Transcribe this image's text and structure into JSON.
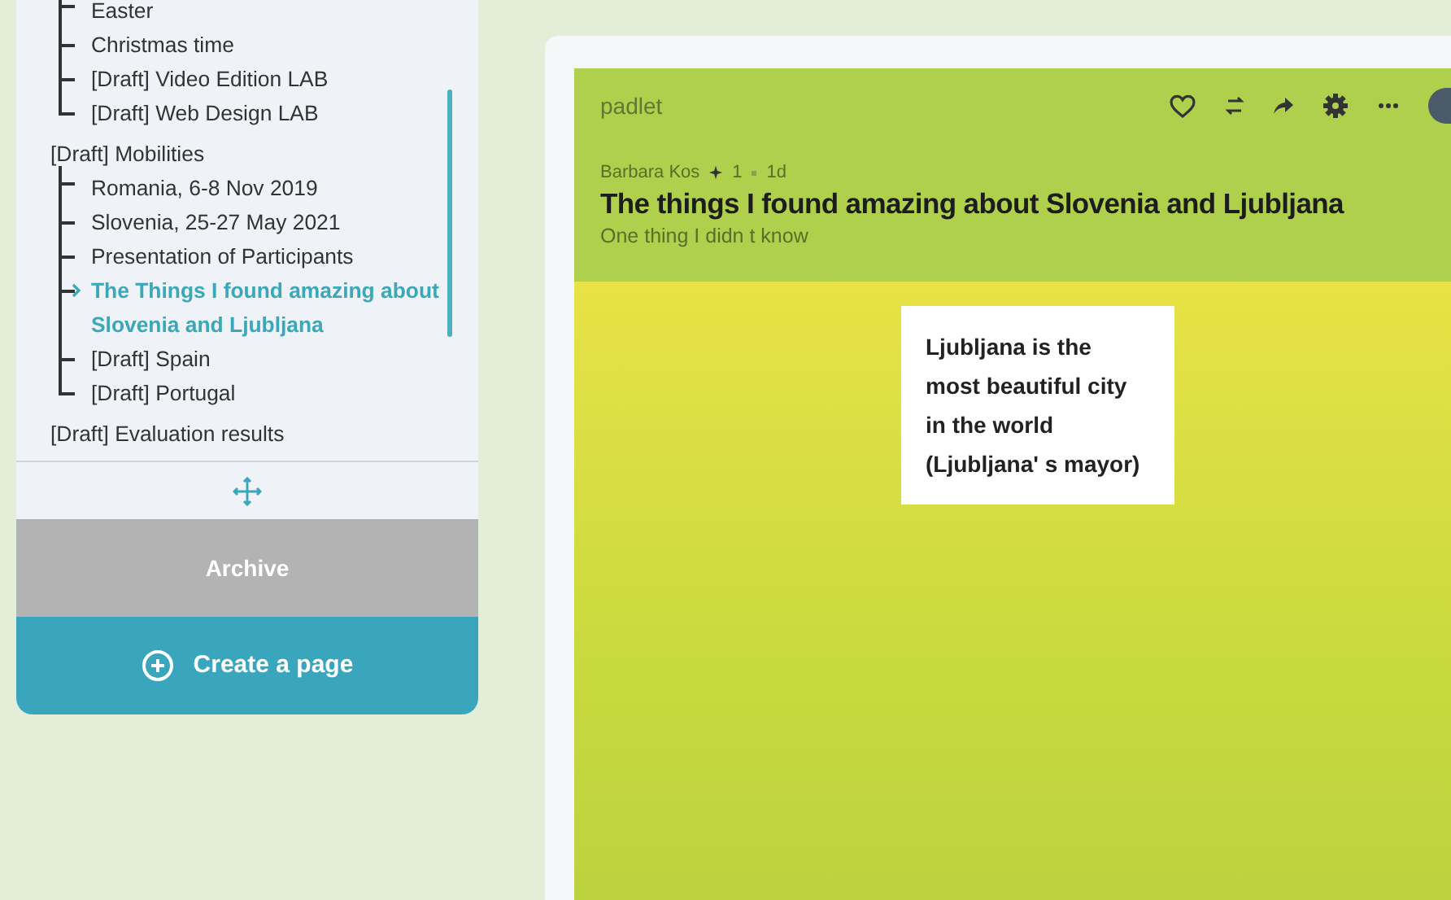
{
  "sidebar": {
    "tree": [
      {
        "children": [
          {
            "label": "Easter",
            "selected": false
          },
          {
            "label": "Christmas time",
            "selected": false
          },
          {
            "label": "[Draft] Video Edition LAB",
            "selected": false
          },
          {
            "label": "[Draft] Web Design LAB",
            "selected": false
          }
        ]
      },
      {
        "label": "[Draft] Mobilities",
        "selected": false,
        "children": [
          {
            "label": "Romania, 6-8 Nov 2019",
            "selected": false
          },
          {
            "label": "Slovenia, 25-27 May 2021",
            "selected": false
          },
          {
            "label": "Presentation of Participants",
            "selected": false
          },
          {
            "label": "The Things I found amazing about Slovenia and Ljubljana",
            "selected": true
          },
          {
            "label": "[Draft] Spain",
            "selected": false
          },
          {
            "label": "[Draft] Portugal",
            "selected": false
          }
        ]
      },
      {
        "label": "[Draft] Evaluation results",
        "selected": false
      }
    ],
    "archive_button": "Archive",
    "create_button": "Create a page"
  },
  "padlet": {
    "brand": "padlet",
    "author": "Barbara Kos",
    "likes": "1",
    "age": "1d",
    "title": "The things I found amazing about Slovenia and Ljubljana",
    "subtitle": "One thing I didn t know",
    "posts": [
      {
        "text": "Ljubljana  is the most beautiful city in the world (Ljubljana' s mayor)"
      }
    ]
  }
}
